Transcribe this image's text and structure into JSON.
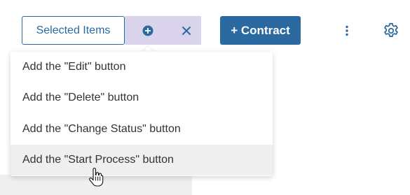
{
  "toolbar": {
    "selected_items_label": "Selected Items",
    "add_contract_label": "+ Contract"
  },
  "dropdown": {
    "items": [
      {
        "label": "Add the \"Edit\" button"
      },
      {
        "label": "Add the \"Delete\" button"
      },
      {
        "label": "Add the \"Change Status\" button"
      },
      {
        "label": "Add the \"Start Process\" button",
        "hovered": true
      }
    ]
  },
  "icons": {
    "add": "plus-circle-icon",
    "close": "close-icon",
    "more": "kebab-vertical-icon",
    "settings": "gear-icon",
    "cursor": "hand-pointer-icon"
  },
  "colors": {
    "primary": "#2b6aa0",
    "action_group_bg": "#d9d4ec",
    "hover_bg": "#efefef",
    "text": "#333333"
  }
}
